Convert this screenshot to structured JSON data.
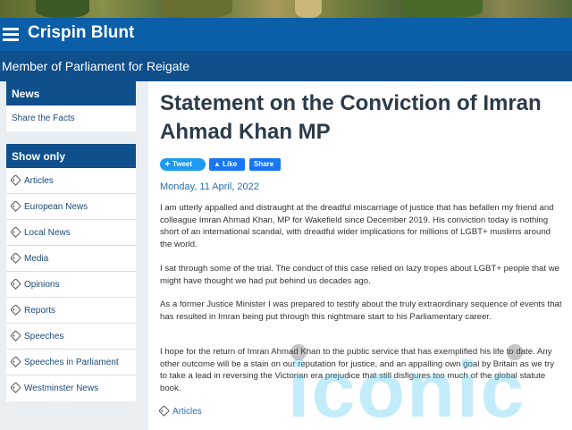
{
  "header": {
    "site_title": "Crispin Blunt",
    "tagline": "Member of Parliament for Reigate"
  },
  "sidebar": {
    "news_box": {
      "heading": "News",
      "items": [
        {
          "label": "Share the Facts"
        }
      ]
    },
    "show_only_box": {
      "heading": "Show only",
      "items": [
        {
          "label": "Articles"
        },
        {
          "label": "European News"
        },
        {
          "label": "Local News"
        },
        {
          "label": "Media"
        },
        {
          "label": "Opinions"
        },
        {
          "label": "Reports"
        },
        {
          "label": "Speeches"
        },
        {
          "label": "Speeches in Parliament"
        },
        {
          "label": "Westminster News"
        }
      ]
    }
  },
  "article": {
    "title": "Statement on the Conviction of Imran Ahmad Khan MP",
    "share": {
      "tweet": "Tweet",
      "like": "Like",
      "share": "Share"
    },
    "date": "Monday, 11 April, 2022",
    "paragraphs": [
      "I am utterly appalled and distraught at the dreadful miscarriage of justice that has befallen my friend and colleague Imran Ahmad Khan, MP for Wakefield since December 2019.  His conviction today is nothing short of an international scandal, with dreadful wider implications for millions of LGBT+ muslims around the world.",
      "I sat through some of the trial. The conduct of this case relied on lazy tropes about LGBT+ people that we might have thought we had put behind us decades ago.",
      "As a former Justice Minister I was prepared to testify about the truly extraordinary sequence of events that has resulted in Imran being put through this nightmare start to his Parliamentary career.",
      "I hope for the return of Imran Ahmad Khan to the public service that has exemplified his life to date. Any other outcome will be a stain on our reputation for justice, and an appalling own goal by Britain as we try to take a lead in reversing the Victorian era prejudice that still disfigures too much of the global statute book."
    ],
    "category": "Articles"
  },
  "watermark": {
    "text": "iconic"
  },
  "icons": {
    "menu": "hamburger-menu-icon",
    "tag": "tag-icon",
    "twitter": "twitter-bird-icon",
    "like": "thumbs-up-icon"
  },
  "colors": {
    "header_blue": "#0b5ea8",
    "nav_dark_blue": "#0e4f8c",
    "link_blue": "#2a6fb0",
    "title_text": "#2b3b4a",
    "page_bg": "#e9eef2"
  }
}
